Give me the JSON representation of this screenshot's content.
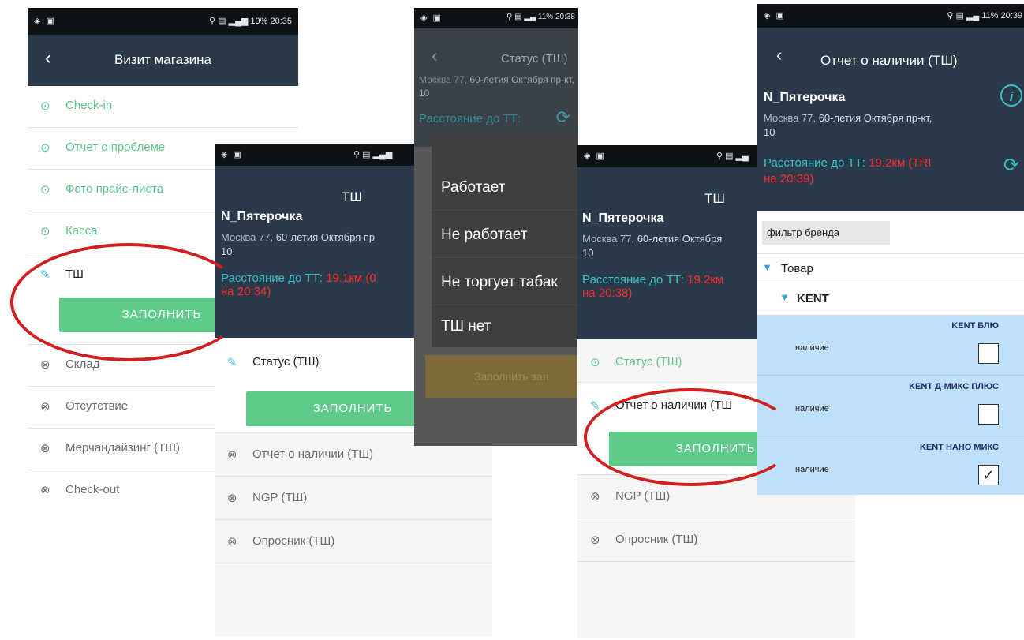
{
  "screen1": {
    "status_right": "10% 20:35",
    "title": "Визит магазина",
    "items": [
      {
        "label": "Check-in"
      },
      {
        "label": "Отчет о проблеме"
      },
      {
        "label": "Фото прайс-листа"
      },
      {
        "label": "Касса"
      },
      {
        "label": "ТШ"
      },
      {
        "label": "Склад"
      },
      {
        "label": "Отсутствие"
      },
      {
        "label": "Мерчандайзинг (ТШ)"
      },
      {
        "label": "Check-out"
      }
    ],
    "fill_button": "ЗАПОЛНИТЬ"
  },
  "screen2": {
    "title": "ТШ",
    "shop_name": "N_Пятерочка",
    "addr_city": "Москва 77,",
    "addr_street": "60-летия Октября пр",
    "addr_line2": "10",
    "dist_label": "Расстояние до ТТ:",
    "dist_value": "19.1км (0",
    "dist_time": "на 20:34)",
    "items": [
      {
        "label": "Статус (ТШ)"
      },
      {
        "label": "Отчет о наличии (ТШ)"
      },
      {
        "label": "NGP (ТШ)"
      },
      {
        "label": "Опросник (ТШ)"
      }
    ],
    "fill_button": "ЗАПОЛНИТЬ"
  },
  "screen3": {
    "status_right": "11% 20:38",
    "title": "Статус (ТШ)",
    "addr_city": "Москва 77,",
    "addr_street": "60-летия Октября пр-кт,",
    "addr_line2": "10",
    "dist_label": "Расстояние до ТТ:",
    "options": [
      {
        "label": "Работает"
      },
      {
        "label": "Не работает"
      },
      {
        "label": "Не торгует табак"
      },
      {
        "label": "ТШ нет"
      }
    ],
    "faded_button": "Заполнить зан"
  },
  "screen4": {
    "title": "ТШ",
    "shop_name": "N_Пятерочка",
    "addr_city": "Москва 77,",
    "addr_street": "60-летия Октября",
    "addr_line2": "10",
    "dist_label": "Расстояние до ТТ:",
    "dist_value": "19.2км",
    "dist_time": "на 20:38)",
    "items": [
      {
        "label": "Статус (ТШ)"
      },
      {
        "label": "Отчет о наличии (ТШ"
      },
      {
        "label": "NGP (ТШ)"
      },
      {
        "label": "Опросник (ТШ)"
      }
    ],
    "fill_button": "ЗАПОЛНИТЬ"
  },
  "screen5": {
    "status_right": "11% 20:39",
    "title": "Отчет о наличии (ТШ)",
    "shop_name": "N_Пятерочка",
    "addr_city": "Москва 77,",
    "addr_street": "60-летия Октября пр-кт,",
    "addr_line2": "10",
    "dist_label": "Расстояние до ТТ:",
    "dist_value": "19.2км (TRI",
    "dist_time": "на 20:39)",
    "filter_placeholder": "фильтр бренда",
    "tree_root": "Товар",
    "tree_brand": "KENT",
    "products": [
      {
        "name": "KENT БЛЮ",
        "label": "наличие",
        "checked": false
      },
      {
        "name": "KENT Д-МИКС ПЛЮС",
        "label": "наличие",
        "checked": false
      },
      {
        "name": "KENT НАНО МИКС",
        "label": "наличие",
        "checked": true
      }
    ]
  },
  "colors": {
    "appbar": "#2b3a4a",
    "green": "#5ecb8b",
    "distance": "#33c2c8",
    "alert": "#ff2b2b",
    "highlight": "#d11f1f"
  }
}
